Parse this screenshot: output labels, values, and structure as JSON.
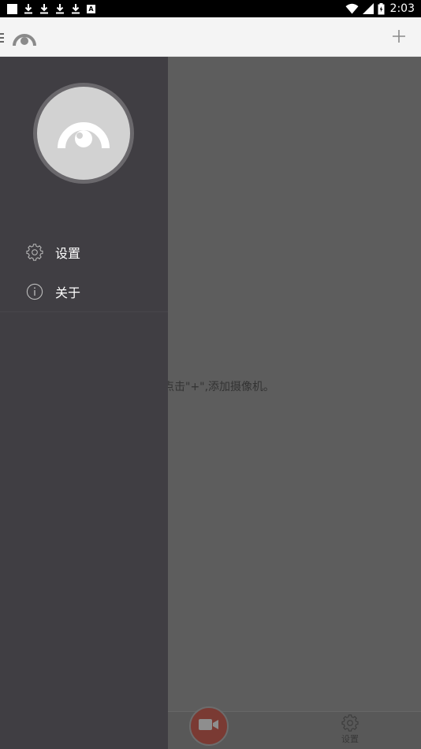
{
  "status_bar": {
    "time": "2:03",
    "notification_icons": [
      "square-notification-icon",
      "download-icon",
      "download-icon",
      "download-icon",
      "download-icon",
      "a-app-icon"
    ],
    "system_icons": [
      "wifi-icon",
      "signal-icon",
      "battery-icon"
    ]
  },
  "app_bar": {
    "icons": [
      "menu-icon",
      "app-logo-icon",
      "add-icon"
    ]
  },
  "drawer": {
    "items": [
      {
        "label": "设置",
        "icon": "gear-icon"
      },
      {
        "label": "关于",
        "icon": "info-icon"
      }
    ]
  },
  "main": {
    "empty_hint": "点击\"+\",添加摄像机。"
  },
  "bottom_bar": {
    "record_icon": "video-camera-icon",
    "settings_label": "设置"
  },
  "colors": {
    "drawer_bg": "#403e43",
    "scrim_area": "#5d5d5d",
    "accent_record": "#7a3a33",
    "app_bar_bg": "#f4f4f4"
  }
}
